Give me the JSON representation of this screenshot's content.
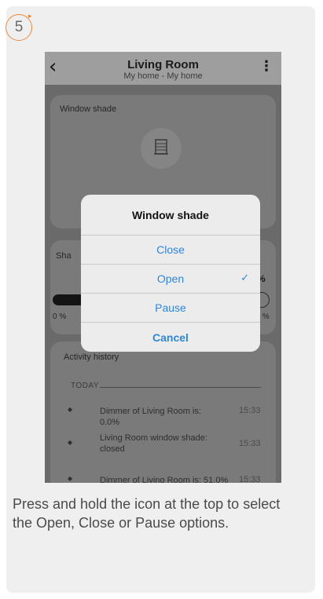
{
  "step": {
    "number": "5"
  },
  "app": {
    "back_icon": "chevron-left-icon",
    "title": "Living Room",
    "subtitle": "My home - My home",
    "more_icon": "more-vertical-icon"
  },
  "window_shade_card": {
    "label": "Window shade",
    "icon": "window-shade-icon"
  },
  "shade_level_card": {
    "label": "Sha",
    "level": "0 %",
    "min_label": "0 %",
    "max_label": "00 %",
    "level_fraction": 0.0
  },
  "activity": {
    "label": "Activity history",
    "section": "TODAY",
    "items": [
      {
        "text": "Dimmer of Living Room is: 0.0%",
        "time": "15:33"
      },
      {
        "text": "Living Room window shade: closed",
        "time": "15:33"
      },
      {
        "text": "Dimmer of Living Room is: 51.0%",
        "time": "15:33"
      }
    ]
  },
  "dialog": {
    "title": "Window shade",
    "options": {
      "close": "Close",
      "open": "Open",
      "pause": "Pause",
      "cancel": "Cancel"
    },
    "selected_mark": "✓"
  },
  "caption": "Press and hold the icon at the top to select the Open, Close or Pause options.",
  "colors": {
    "accent": "#e8893a",
    "dialog_button": "#2f86d6",
    "overlay": "#6a6a6a"
  }
}
